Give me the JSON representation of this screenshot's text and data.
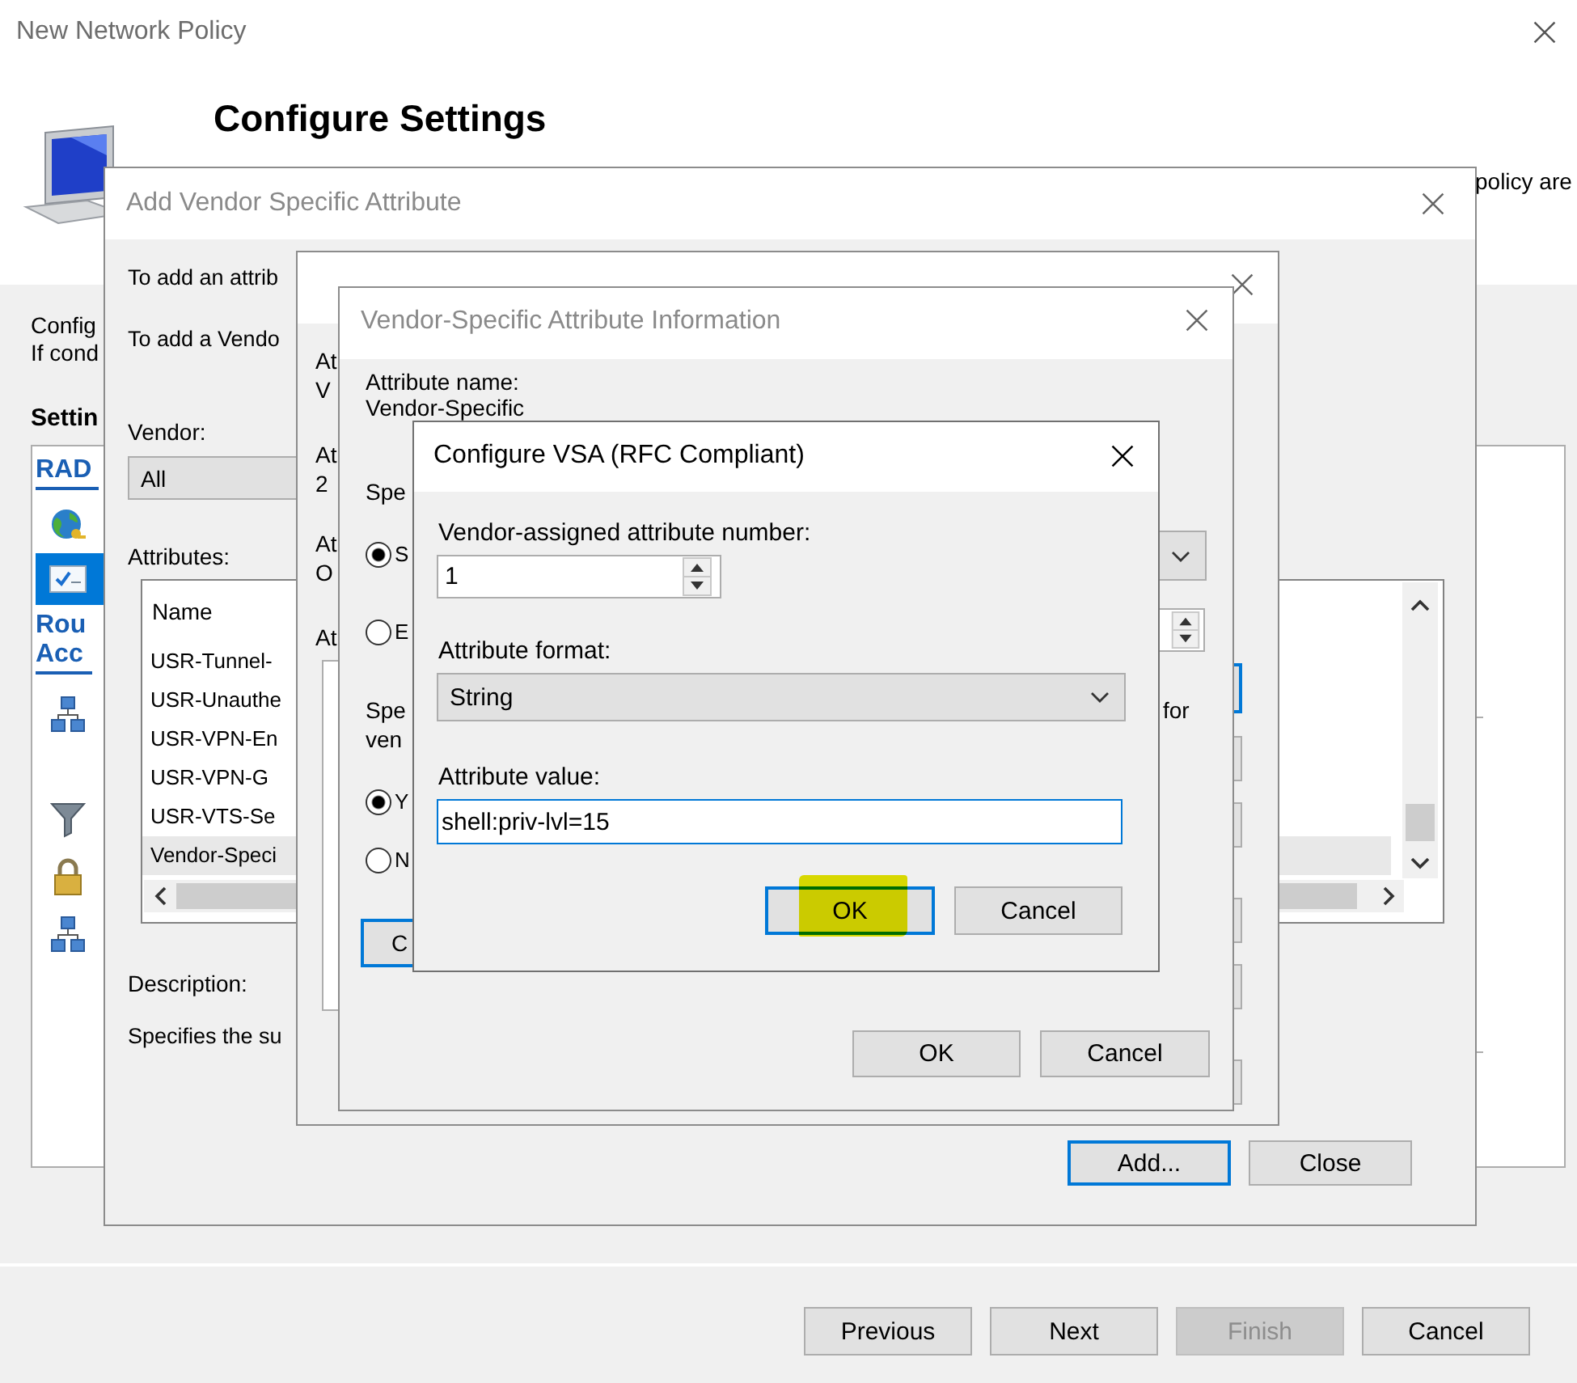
{
  "main_window": {
    "title": "New Network Policy",
    "heading": "Configure Settings",
    "heading_tail": "policy are",
    "intro_lines": [
      "Config",
      "If cond"
    ],
    "settings_label": "Settin",
    "sidebar": [
      {
        "kind": "link",
        "lines": [
          "RAD"
        ]
      },
      {
        "kind": "icon",
        "selected": false
      },
      {
        "kind": "icon",
        "selected": true
      },
      {
        "kind": "link",
        "lines": [
          "Rou",
          "Acc"
        ]
      },
      {
        "kind": "icon",
        "selected": false
      },
      {
        "kind": "icon",
        "selected": false
      },
      {
        "kind": "icon",
        "selected": false
      },
      {
        "kind": "icon",
        "selected": false
      }
    ],
    "buttons": [
      {
        "label": "Previous",
        "disabled": false
      },
      {
        "label": "Next",
        "disabled": false
      },
      {
        "label": "Finish",
        "disabled": true
      },
      {
        "label": "Cancel",
        "disabled": false
      }
    ]
  },
  "vendor_attribute_dialog": {
    "title": "Add Vendor Specific Attribute",
    "intro_lines": [
      "To add an attrib",
      "To add a Vendo"
    ],
    "vendor_label": "Vendor:",
    "vendor_value": "All",
    "attributes_label": "Attributes:",
    "list_column": "Name",
    "rows": [
      {
        "name": "USR-Tunnel-",
        "selected": false
      },
      {
        "name": "USR-Unauthe",
        "selected": false
      },
      {
        "name": "USR-VPN-En",
        "selected": false
      },
      {
        "name": "USR-VPN-G",
        "selected": false
      },
      {
        "name": "USR-VTS-Se",
        "selected": false
      },
      {
        "name": "Vendor-Speci",
        "selected": true
      }
    ],
    "description_label": "Description:",
    "description": "Specifies the su",
    "buttons": [
      {
        "label": "Add...",
        "focused": true
      },
      {
        "label": "Close",
        "focused": false
      }
    ]
  },
  "attribute_information_dialog": {
    "label_fragments": [
      [
        "At",
        "V"
      ],
      [
        "At",
        "2"
      ],
      [
        "At",
        "O"
      ],
      [
        "At"
      ]
    ],
    "side_buttons": [
      {
        "focused": true
      },
      {
        "focused": false
      },
      {
        "focused": false
      },
      {
        "focused": false
      },
      {
        "focused": false
      },
      {
        "focused": false
      }
    ]
  },
  "vsa_information_dialog": {
    "title": "Vendor-Specific Attribute Information",
    "attribute_name_label": "Attribute name:",
    "attribute_name": "Vendor-Specific",
    "format_label": "Spe",
    "format_options": [
      {
        "label": "S",
        "selected": true
      },
      {
        "label": "E",
        "selected": false
      }
    ],
    "vendor_label_lines": [
      "Spe",
      "ven"
    ],
    "vendor_label_end": "for",
    "conformance_options": [
      {
        "label": "Y",
        "selected": true
      },
      {
        "label": "N",
        "selected": false
      }
    ],
    "configure_button": "C",
    "buttons": [
      "OK",
      "Cancel"
    ]
  },
  "configure_vsa_dialog": {
    "title": "Configure VSA (RFC Compliant)",
    "number_label": "Vendor-assigned attribute number:",
    "number_value": "1",
    "format_label": "Attribute format:",
    "format_value": "String",
    "value_label": "Attribute value:",
    "value": "shell:priv-lvl=15",
    "buttons": [
      {
        "label": "OK",
        "focused": true,
        "highlighted": true
      },
      {
        "label": "Cancel",
        "focused": false,
        "highlighted": false
      }
    ]
  }
}
